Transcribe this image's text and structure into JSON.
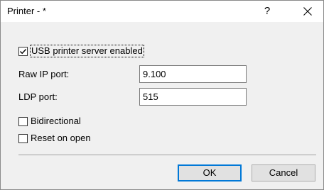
{
  "window": {
    "title": "Printer - *",
    "help_glyph": "?",
    "close_icon": "close-icon"
  },
  "form": {
    "usb_server": {
      "label": "USB printer server enabled",
      "checked": true
    },
    "raw_ip_port": {
      "label": "Raw IP port:",
      "value": "9.100"
    },
    "ldp_port": {
      "label": "LDP port:",
      "value": "515"
    },
    "bidirectional": {
      "label": "Bidirectional",
      "checked": false
    },
    "reset_on_open": {
      "label": "Reset on open",
      "checked": false
    }
  },
  "buttons": {
    "ok_label": "OK",
    "cancel_label": "Cancel"
  },
  "colors": {
    "dialog_background": "#f0f0f0",
    "default_button_border": "#0078d7"
  }
}
